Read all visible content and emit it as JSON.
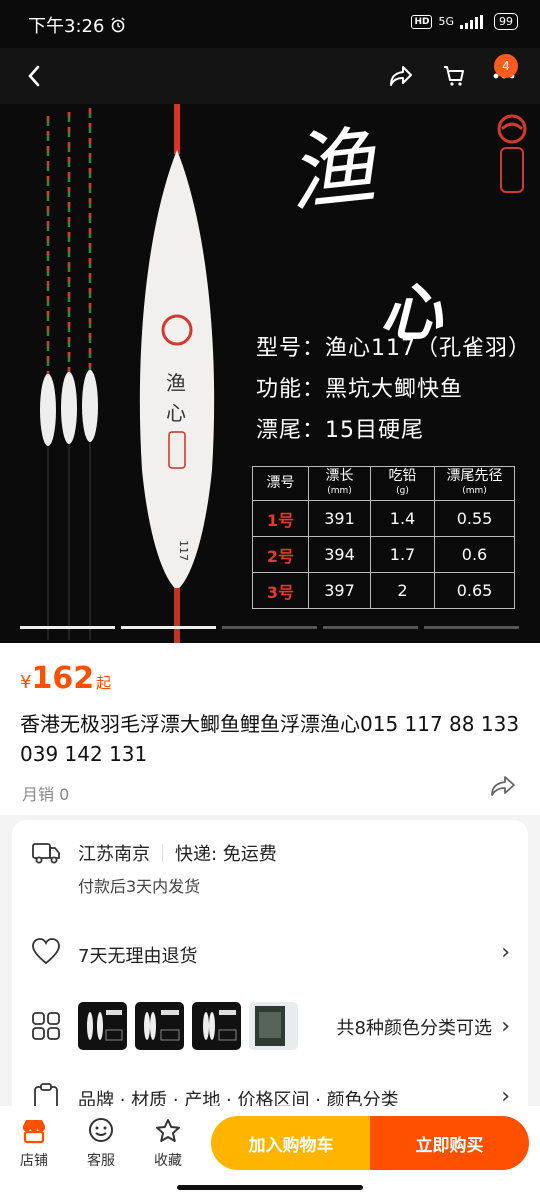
{
  "status_bar": {
    "time": "下午3:26",
    "hd": "HD",
    "network": "5G",
    "battery": "99"
  },
  "navbar": {
    "cart_count": "4"
  },
  "hero": {
    "brand_char": "渔",
    "brand_sub": "心",
    "spec_lines": [
      "型号：渔心117（孔雀羽）",
      "功能：黑坑大鲫快鱼",
      "漂尾：15目硬尾"
    ],
    "table": {
      "headers": [
        {
          "label": "漂号",
          "unit": ""
        },
        {
          "label": "漂长",
          "unit": "(mm)"
        },
        {
          "label": "吃铅",
          "unit": "(g)"
        },
        {
          "label": "漂尾先径",
          "unit": "(mm)"
        }
      ],
      "rows": [
        [
          "1号",
          "391",
          "1.4",
          "0.55"
        ],
        [
          "2号",
          "394",
          "1.7",
          "0.6"
        ],
        [
          "3号",
          "397",
          "2",
          "0.65"
        ]
      ]
    },
    "carousel_active": 2,
    "carousel_total": 5
  },
  "product": {
    "currency": "¥",
    "price": "162",
    "price_suffix": "起",
    "title": "香港无极羽毛浮漂大鲫鱼鲤鱼浮漂渔心015 117 88 133 039 142 131",
    "sales": "月销 0"
  },
  "service": {
    "origin": "江苏南京",
    "shipping": "快递: 免运费",
    "dispatch": "付款后3天内发货",
    "returns": "7天无理由退货",
    "variants_text": "共8种颜色分类可选",
    "attributes": "品牌 · 材质 · 产地 · 价格区间 · 颜色分类"
  },
  "bottom_bar": {
    "store": "店铺",
    "service": "客服",
    "favorite": "收藏",
    "add_to_cart": "加入购物车",
    "buy_now": "立即购买"
  },
  "colors": {
    "accent": "#ff5000",
    "cart_button": "#ffb500",
    "hero_bg": "#0b0b0b"
  }
}
